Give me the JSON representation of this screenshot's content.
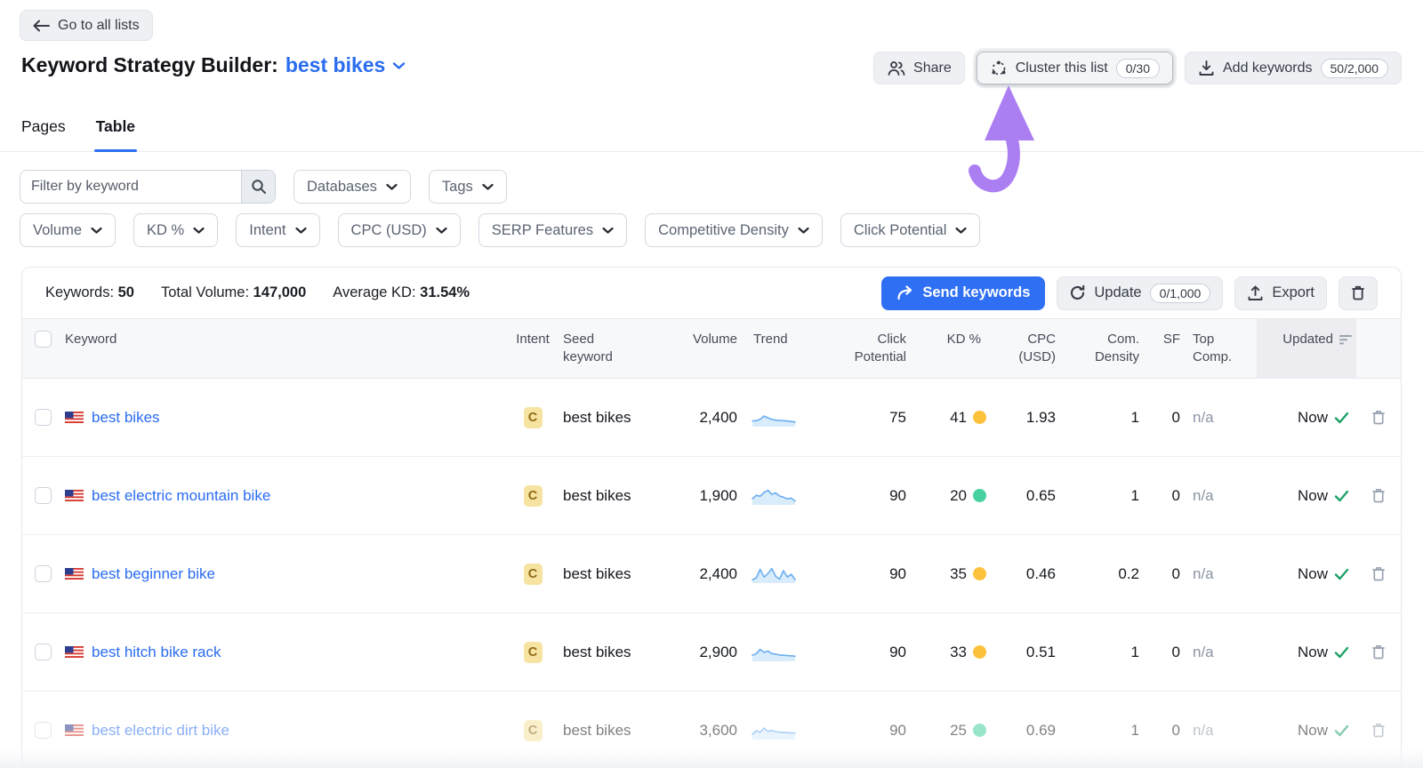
{
  "header": {
    "back_button": "Go to all lists",
    "title": "Keyword Strategy Builder:",
    "list_name": "best bikes",
    "actions": {
      "share": "Share",
      "cluster": "Cluster this list",
      "cluster_count": "0/30",
      "add_keywords": "Add keywords",
      "add_keywords_count": "50/2,000"
    }
  },
  "tabs": [
    {
      "label": "Pages",
      "active": false
    },
    {
      "label": "Table",
      "active": true
    }
  ],
  "filters": {
    "search_placeholder": "Filter by keyword",
    "row1": [
      "Databases",
      "Tags"
    ],
    "row2": [
      "Volume",
      "KD %",
      "Intent",
      "CPC (USD)",
      "SERP Features",
      "Competitive Density",
      "Click Potential"
    ]
  },
  "summary": {
    "keywords_label": "Keywords:",
    "keywords_value": "50",
    "volume_label": "Total Volume:",
    "volume_value": "147,000",
    "kd_label": "Average KD:",
    "kd_value": "31.54%"
  },
  "toolbar": {
    "send": "Send keywords",
    "update": "Update",
    "update_count": "0/1,000",
    "export": "Export"
  },
  "table": {
    "columns": [
      "Keyword",
      "Intent",
      "Seed keyword",
      "Volume",
      "Trend",
      "Click Potential",
      "KD %",
      "CPC (USD)",
      "Com. Density",
      "SF",
      "Top Comp.",
      "Updated"
    ],
    "rows": [
      {
        "keyword": "best bikes",
        "flag": "us",
        "intent": "C",
        "seed": "best bikes",
        "volume": "2,400",
        "trend": [
          0.28,
          0.3,
          0.4,
          0.62,
          0.5,
          0.38,
          0.34,
          0.3,
          0.3,
          0.27,
          0.24,
          0.2
        ],
        "click_potential": "75",
        "kd": "41",
        "kd_level": "medium",
        "cpc": "1.93",
        "com_density": "1",
        "sf": "0",
        "top_comp": "n/a",
        "updated": "Now",
        "faded": false
      },
      {
        "keyword": "best electric mountain bike",
        "flag": "us",
        "intent": "C",
        "seed": "best bikes",
        "volume": "1,900",
        "trend": [
          0.3,
          0.55,
          0.48,
          0.75,
          0.9,
          0.62,
          0.72,
          0.5,
          0.42,
          0.3,
          0.35,
          0.15
        ],
        "click_potential": "90",
        "kd": "20",
        "kd_level": "easy",
        "cpc": "0.65",
        "com_density": "1",
        "sf": "0",
        "top_comp": "n/a",
        "updated": "Now",
        "faded": false
      },
      {
        "keyword": "best beginner bike",
        "flag": "us",
        "intent": "C",
        "seed": "best bikes",
        "volume": "2,400",
        "trend": [
          0.1,
          0.25,
          0.85,
          0.3,
          0.55,
          0.9,
          0.35,
          0.15,
          0.75,
          0.3,
          0.5,
          0.12
        ],
        "click_potential": "90",
        "kd": "35",
        "kd_level": "medium",
        "cpc": "0.46",
        "com_density": "0.2",
        "sf": "0",
        "top_comp": "n/a",
        "updated": "Now",
        "faded": false
      },
      {
        "keyword": "best hitch bike rack",
        "flag": "us",
        "intent": "C",
        "seed": "best bikes",
        "volume": "2,900",
        "trend": [
          0.3,
          0.42,
          0.72,
          0.5,
          0.6,
          0.42,
          0.38,
          0.32,
          0.3,
          0.28,
          0.26,
          0.24
        ],
        "click_potential": "90",
        "kd": "33",
        "kd_level": "medium",
        "cpc": "0.51",
        "com_density": "1",
        "sf": "0",
        "top_comp": "n/a",
        "updated": "Now",
        "faded": false
      },
      {
        "keyword": "best electric dirt bike",
        "flag": "us",
        "intent": "C",
        "seed": "best bikes",
        "volume": "3,600",
        "trend": [
          0.25,
          0.5,
          0.38,
          0.68,
          0.45,
          0.52,
          0.42,
          0.4,
          0.36,
          0.36,
          0.34,
          0.33
        ],
        "click_potential": "90",
        "kd": "25",
        "kd_level": "easy",
        "cpc": "0.69",
        "com_density": "1",
        "sf": "0",
        "top_comp": "n/a",
        "updated": "Now",
        "faded": true
      }
    ]
  },
  "colors": {
    "accent_blue": "#2f6ff4",
    "link_blue": "#2a6cf0",
    "kd_medium": "#fcc23c",
    "kd_easy": "#47d1a0",
    "check_green": "#1fa268",
    "intent_bg": "#f6e3a1",
    "intent_text": "#8f6a14",
    "arrow_purple": "#ab7ef2",
    "trend_line": "#6aaef0",
    "trend_fill": "#d9ecfb"
  }
}
